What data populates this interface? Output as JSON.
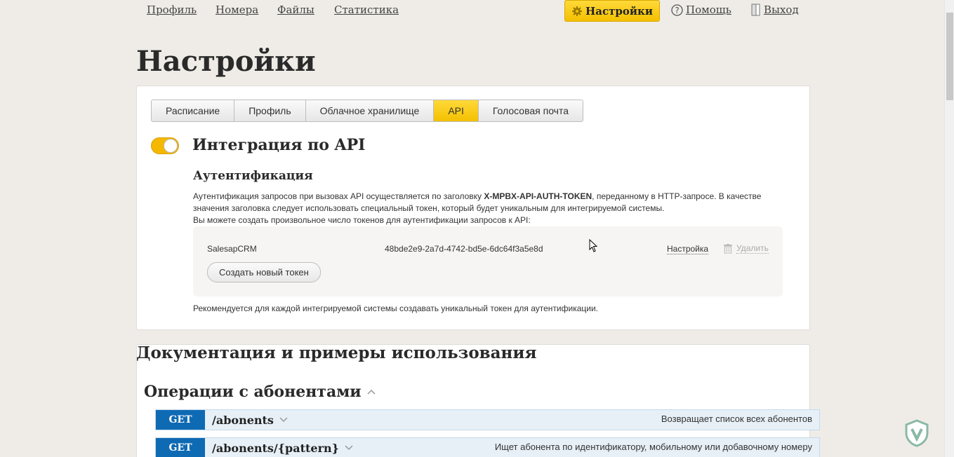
{
  "nav": {
    "links": [
      "Профиль",
      "Номера",
      "Файлы",
      "Статистика"
    ],
    "settings": "Настройки",
    "help": "Помощь",
    "logout": "Выход"
  },
  "page": {
    "title": "Настройки"
  },
  "tabs": [
    "Расписание",
    "Профиль",
    "Облачное хранилище",
    "API",
    "Голосовая почта"
  ],
  "api": {
    "heading": "Интеграция по API",
    "auth_heading": "Аутентификация",
    "desc_1": "Аутентификация запросов при вызовах API осуществляется по заголовку ",
    "desc_token": "X-MPBX-API-AUTH-TOKEN",
    "desc_2": ", переданному в HTTP-запросе. В качестве значения заголовка следует использовать специальный токен, который будет уникальным для интегрируемой системы.",
    "desc_3": "Вы можете создать произвольное число токенов для аутентификации запросов к API:",
    "token": {
      "name": "SalesapCRM",
      "value": "48bde2e9-2a7d-4742-bd5e-6dc64f3a5e8d",
      "settings": "Настройка",
      "delete": "Удалить"
    },
    "new_token": "Создать новый токен",
    "note": "Рекомендуется для каждой интегрируемой системы создавать уникальный токен для аутентификации."
  },
  "docs": {
    "heading": "Документация и примеры использования",
    "section": "Операции с абонентами",
    "endpoints": [
      {
        "method": "GET",
        "path": "/abonents",
        "desc": "Возвращает список всех абонентов"
      },
      {
        "method": "GET",
        "path": "/abonents/{pattern}",
        "desc": "Ищет абонента по идентификатору, мобильному или добавочному номеру"
      }
    ]
  },
  "colors": {
    "accent": "#f4c000",
    "method": "#0f6ab4",
    "endpoint_bg": "#e7f0f7"
  }
}
